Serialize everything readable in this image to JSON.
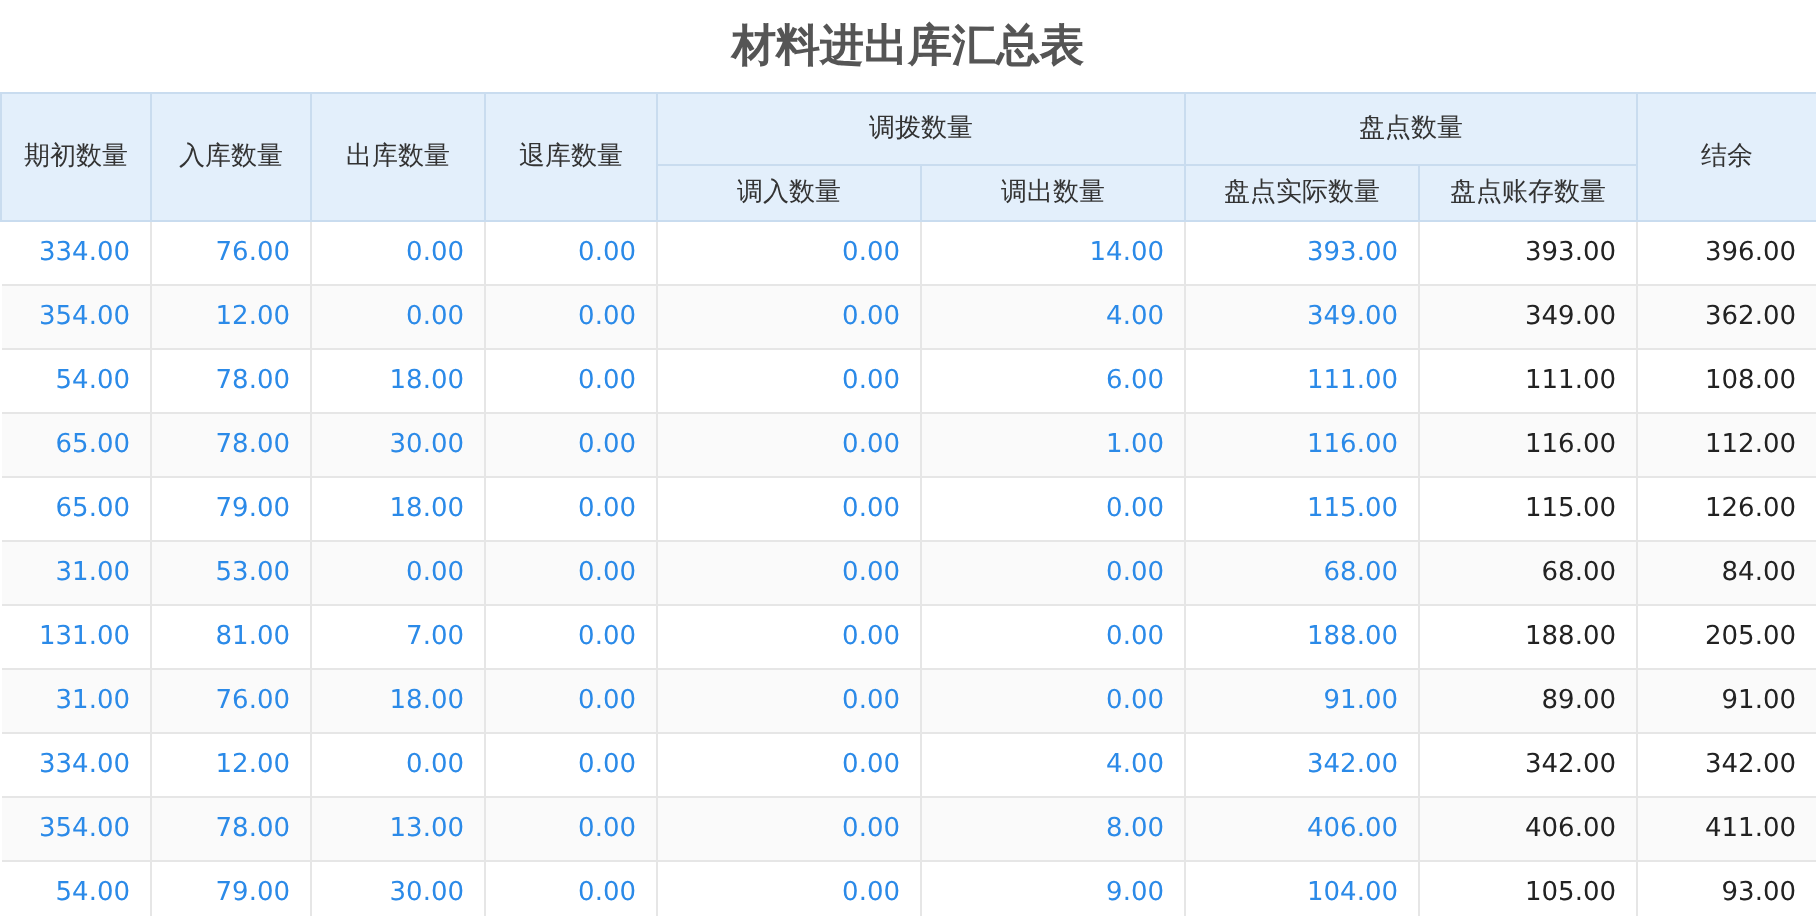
{
  "title": "材料进出库汇总表",
  "columns": [
    {
      "label": "期初数量",
      "kind": "link"
    },
    {
      "label": "入库数量",
      "kind": "link"
    },
    {
      "label": "出库数量",
      "kind": "link"
    },
    {
      "label": "退库数量",
      "kind": "link"
    },
    {
      "label": "调拨数量",
      "children": [
        {
          "label": "调入数量",
          "kind": "link"
        },
        {
          "label": "调出数量",
          "kind": "link"
        }
      ]
    },
    {
      "label": "盘点数量",
      "children": [
        {
          "label": "盘点实际数量",
          "kind": "link"
        },
        {
          "label": "盘点账存数量",
          "kind": "plain"
        }
      ]
    },
    {
      "label": "结余",
      "kind": "plain"
    }
  ],
  "rows": [
    [
      "334.00",
      "76.00",
      "0.00",
      "0.00",
      "0.00",
      "14.00",
      "393.00",
      "393.00",
      "396.00"
    ],
    [
      "354.00",
      "12.00",
      "0.00",
      "0.00",
      "0.00",
      "4.00",
      "349.00",
      "349.00",
      "362.00"
    ],
    [
      "54.00",
      "78.00",
      "18.00",
      "0.00",
      "0.00",
      "6.00",
      "111.00",
      "111.00",
      "108.00"
    ],
    [
      "65.00",
      "78.00",
      "30.00",
      "0.00",
      "0.00",
      "1.00",
      "116.00",
      "116.00",
      "112.00"
    ],
    [
      "65.00",
      "79.00",
      "18.00",
      "0.00",
      "0.00",
      "0.00",
      "115.00",
      "115.00",
      "126.00"
    ],
    [
      "31.00",
      "53.00",
      "0.00",
      "0.00",
      "0.00",
      "0.00",
      "68.00",
      "68.00",
      "84.00"
    ],
    [
      "131.00",
      "81.00",
      "7.00",
      "0.00",
      "0.00",
      "0.00",
      "188.00",
      "188.00",
      "205.00"
    ],
    [
      "31.00",
      "76.00",
      "18.00",
      "0.00",
      "0.00",
      "0.00",
      "91.00",
      "89.00",
      "91.00"
    ],
    [
      "334.00",
      "12.00",
      "0.00",
      "0.00",
      "0.00",
      "4.00",
      "342.00",
      "342.00",
      "342.00"
    ],
    [
      "354.00",
      "78.00",
      "13.00",
      "0.00",
      "0.00",
      "8.00",
      "406.00",
      "406.00",
      "411.00"
    ],
    [
      "54.00",
      "79.00",
      "30.00",
      "0.00",
      "0.00",
      "9.00",
      "104.00",
      "105.00",
      "93.00"
    ]
  ]
}
